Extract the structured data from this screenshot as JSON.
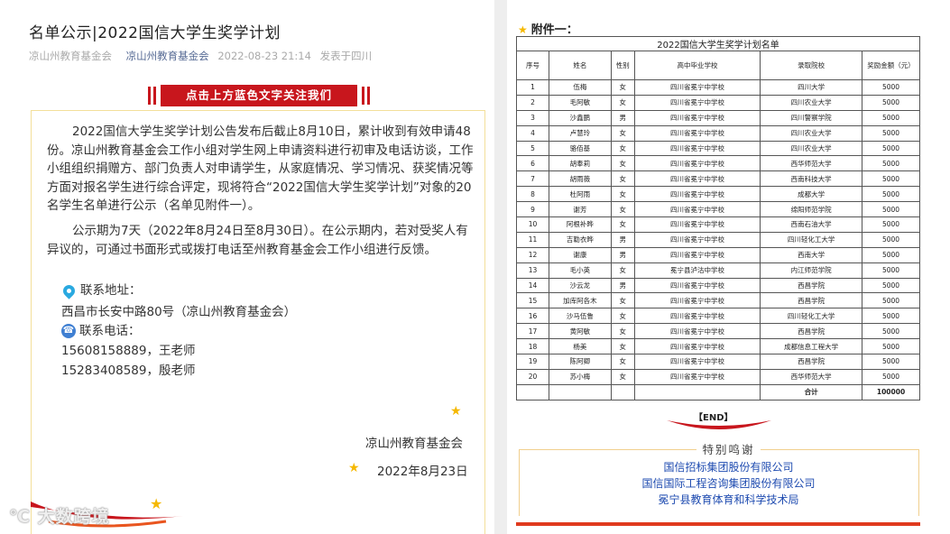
{
  "article": {
    "title": "名单公示|2022国信大学生奖学计划",
    "meta": {
      "source": "凉山州教育基金会",
      "account_link": "凉山州教育基金会",
      "datetime": "2022-08-23 21:14",
      "location": "发表于四川"
    },
    "follow_banner": "点击上方蓝色文字关注我们",
    "paragraph1": "2022国信大学生奖学计划公告发布后截止8月10日，累计收到有效申请48份。凉山州教育基金会工作小组对学生网上申请资料进行初审及电话访谈，工作小组组织捐赠方、部门负责人对申请学生，从家庭情况、学习情况、获奖情况等方面对报名学生进行综合评定，现将符合“2022国信大学生奖学计划”对象的20名学生名单进行公示（名单见附件一）。",
    "paragraph2": "公示期为7天（2022年8月24日至8月30日）。在公示期内，若对受奖人有异议的，可通过书面形式或拨打电话至州教育基金会工作小组进行反馈。",
    "contact": {
      "address_label": "联系地址：",
      "address": "西昌市长安中路80号（凉山州教育基金会）",
      "phone_label": "联系电话：",
      "phone1": "15608158889，王老师",
      "phone2": "15283408589，殷老师"
    },
    "signature": "凉山州教育基金会",
    "date": "2022年8月23日",
    "watermark": "大数跨境"
  },
  "attachment": {
    "heading": "附件一：",
    "table_title": "2022国信大学生奖学计划名单",
    "headers": [
      "序号",
      "姓名",
      "性别",
      "高中毕业学校",
      "录取院校",
      "奖励金额（元）"
    ],
    "rows": [
      [
        "1",
        "伍梅",
        "女",
        "四川省冕宁中学校",
        "四川大学",
        "5000"
      ],
      [
        "2",
        "毛阿敏",
        "女",
        "四川省冕宁中学校",
        "四川农业大学",
        "5000"
      ],
      [
        "3",
        "沙鑫鹏",
        "男",
        "四川省冕宁中学校",
        "四川警察学院",
        "5000"
      ],
      [
        "4",
        "卢慧玲",
        "女",
        "四川省冕宁中学校",
        "四川农业大学",
        "5000"
      ],
      [
        "5",
        "骆佰基",
        "女",
        "四川省冕宁中学校",
        "四川农业大学",
        "5000"
      ],
      [
        "6",
        "胡奉莉",
        "女",
        "四川省冕宁中学校",
        "西华师范大学",
        "5000"
      ],
      [
        "7",
        "胡雨薇",
        "女",
        "四川省冕宁中学校",
        "西南科技大学",
        "5000"
      ],
      [
        "8",
        "杜阿雨",
        "女",
        "四川省冕宁中学校",
        "成都大学",
        "5000"
      ],
      [
        "9",
        "谢芳",
        "女",
        "四川省冕宁中学校",
        "绵阳师范学院",
        "5000"
      ],
      [
        "10",
        "阿根补晔",
        "女",
        "四川省冕宁中学校",
        "西南石油大学",
        "5000"
      ],
      [
        "11",
        "吉勒衣晔",
        "男",
        "四川省冕宁中学校",
        "四川轻化工大学",
        "5000"
      ],
      [
        "12",
        "谢康",
        "男",
        "四川省冕宁中学校",
        "西南大学",
        "5000"
      ],
      [
        "13",
        "毛小英",
        "女",
        "冕宁县泸沽中学校",
        "内江师范学院",
        "5000"
      ],
      [
        "14",
        "沙云龙",
        "男",
        "四川省冕宁中学校",
        "西昌学院",
        "5000"
      ],
      [
        "15",
        "加库阿各木",
        "女",
        "四川省冕宁中学校",
        "西昌学院",
        "5000"
      ],
      [
        "16",
        "沙马伍鲁",
        "女",
        "四川省冕宁中学校",
        "四川轻化工大学",
        "5000"
      ],
      [
        "17",
        "黄阿敏",
        "女",
        "四川省冕宁中学校",
        "西昌学院",
        "5000"
      ],
      [
        "18",
        "杨美",
        "女",
        "四川省冕宁中学校",
        "成都信息工程大学",
        "5000"
      ],
      [
        "19",
        "陈阿卿",
        "女",
        "四川省冕宁中学校",
        "西昌学院",
        "5000"
      ],
      [
        "20",
        "苏小梅",
        "女",
        "四川省冕宁中学校",
        "西华师范大学",
        "5000"
      ]
    ],
    "total_label": "合计",
    "total_value": "100000",
    "end_label": "【END】",
    "thanks_title": "特别鸣谢",
    "sponsors": [
      "国信招标集团股份有限公司",
      "国信国际工程咨询集团股份有限公司",
      "冕宁县教育体育和科学技术局"
    ]
  },
  "colors": {
    "accent_red": "#c8161d",
    "link_blue": "#576b95",
    "sponsor_blue": "#1e4bb0",
    "star_gold": "#f5b800"
  }
}
